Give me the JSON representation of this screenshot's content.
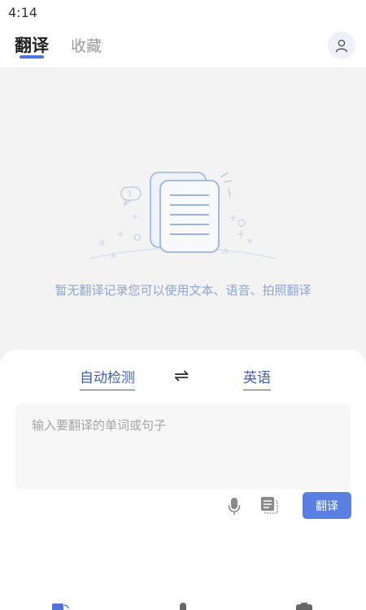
{
  "status_bar": {
    "time": "4:14"
  },
  "header": {
    "tabs": [
      {
        "label": "翻译",
        "active": true
      },
      {
        "label": "收藏",
        "active": false
      }
    ]
  },
  "empty_state": {
    "message": "暂无翻译记录您可以使用文本、语音、拍照翻译"
  },
  "translator": {
    "source_lang": "自动检测",
    "target_lang": "英语",
    "swap_symbol": "⇌",
    "input_placeholder": "输入要翻译的单词或句子",
    "input_value": "",
    "translate_label": "翻译"
  },
  "colors": {
    "accent": "#5a7fe3",
    "lang_text": "#3d5fb8",
    "empty_text": "#8ea6d2"
  },
  "icons": {
    "avatar": "user-icon",
    "mic": "microphone-icon",
    "doc": "document-scan-icon",
    "bottom_nav": [
      "translate-icon",
      "voice-icon",
      "camera-icon"
    ]
  }
}
